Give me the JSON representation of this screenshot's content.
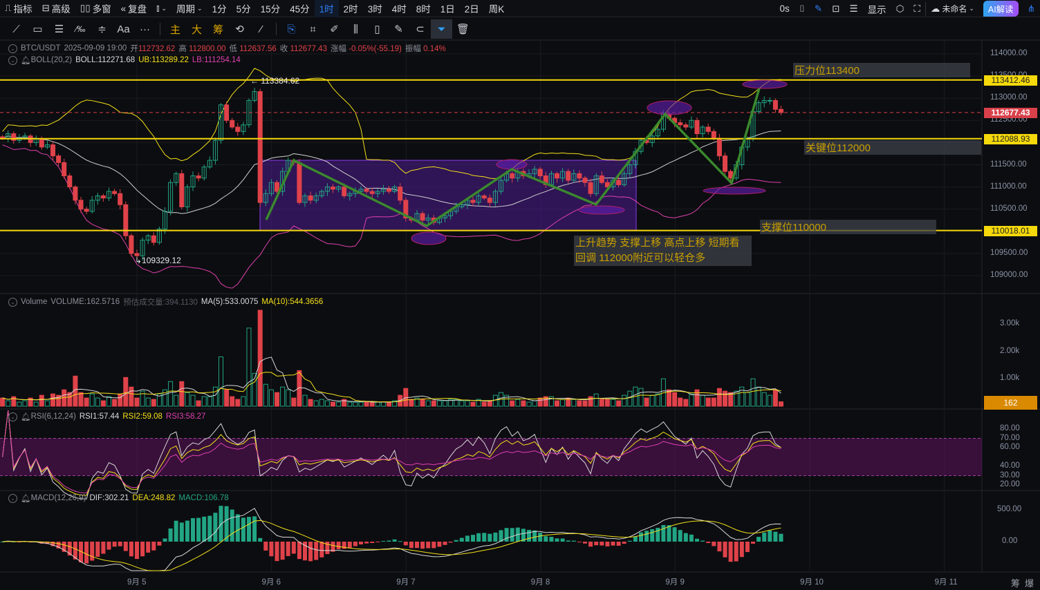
{
  "topbar": {
    "left": [
      {
        "label": "指标",
        "icon": "chart-icon"
      },
      {
        "label": "高级",
        "icon": "layout-icon"
      },
      {
        "label": "多窗",
        "icon": "grid-icon"
      },
      {
        "label": "复盘",
        "icon": "rewind-icon"
      }
    ],
    "chart_type_icon": "candlestick-icon",
    "period_label": "周期",
    "intervals": [
      "1分",
      "5分",
      "15分",
      "45分",
      "1时",
      "2时",
      "3时",
      "4时",
      "8时",
      "1日",
      "2日",
      "周K"
    ],
    "active_interval": "1时",
    "countdown": "0s",
    "display_label": "显示",
    "layout_name": "未命名",
    "ai_label": "AI解读"
  },
  "drawbar": {
    "text_tool": "Aa",
    "more": "···",
    "main": "主",
    "big": "大",
    "chips": "筹"
  },
  "ohlc": {
    "symbol": "BTC/USDT",
    "time": "2025-09-09 19:00",
    "open_label": "开",
    "open": "112732.62",
    "high_label": "高",
    "high": "112800.00",
    "low_label": "低",
    "low": "112637.56",
    "close_label": "收",
    "close": "112677.43",
    "change_label": "涨幅",
    "change": "-0.05%(-55.19)",
    "amp_label": "振幅",
    "amp": "0.14%"
  },
  "boll": {
    "name": "BOLL(20,2)",
    "mid": "BOLL:112271.68",
    "ub": "UB:113289.22",
    "lb": "LB:111254.14"
  },
  "volume": {
    "name": "Volume",
    "value": "VOLUME:162.5716",
    "est_label": "预估成交量",
    "est": ":394.1130",
    "ma5": "MA(5):533.0075",
    "ma10": "MA(10):544.3656"
  },
  "rsi": {
    "name": "RSI(6,12,24)",
    "rsi1": "RSI1:57.44",
    "rsi2": "RSI2:59.08",
    "rsi3": "RSI3:58.27"
  },
  "macd": {
    "name": "MACD(12,26,9)",
    "dif": "DIF:302.21",
    "dea": "DEA:248.82",
    "macd": "MACD:106.78"
  },
  "price_axis": [
    "114000.00",
    "113500.00",
    "113000.00",
    "112500.00",
    "112000.00",
    "111500.00",
    "111000.00",
    "110500.00",
    "110000.00",
    "109500.00",
    "109000.00"
  ],
  "price_tags": {
    "resistance": "113412.46",
    "current": "112677.43",
    "key": "112088.93",
    "support": "110018.01"
  },
  "volume_axis": [
    "3.00k",
    "2.00k",
    "1.00k"
  ],
  "volume_tag": "162",
  "rsi_axis": [
    "80.00",
    "70.00",
    "60.00",
    "40.00",
    "30.00",
    "20.00"
  ],
  "macd_axis": [
    "500.00",
    "0.00"
  ],
  "date_axis": [
    "9月 5",
    "9月 6",
    "9月 7",
    "9月 8",
    "9月 9",
    "9月 10",
    "9月 11"
  ],
  "bottom_right": [
    "筹",
    "爆"
  ],
  "annotations": {
    "resistance": "压力位113400",
    "key": "关键位112000",
    "support": "支撑位110000",
    "comment_line1": "上升趋势 支撑上移 高点上移 短期看",
    "comment_line2": "回调  112000附近可以轻仓多",
    "high_mark": "113384.62",
    "low_mark": "109329.12"
  },
  "colors": {
    "up": "#22a584",
    "down": "#e0424a",
    "boll_mid": "#d0d0d0",
    "boll_ub": "#f5e11a",
    "boll_lb": "#e040b0",
    "level": "#f5d90a",
    "accent": "#2f7ef5"
  },
  "chart_data": {
    "type": "candlestick",
    "interval": "1h",
    "start": "2025-09-04 00:00",
    "closes": [
      112100,
      112200,
      112050,
      112100,
      112150,
      112000,
      112080,
      111900,
      111950,
      111700,
      111550,
      111250,
      111000,
      110700,
      110500,
      110450,
      110700,
      110800,
      110750,
      110900,
      110850,
      110600,
      109900,
      109500,
      109450,
      109800,
      109900,
      109750,
      110050,
      110450,
      111100,
      111300,
      110550,
      111000,
      111250,
      111200,
      111450,
      111600,
      112050,
      112850,
      112500,
      112350,
      112250,
      112400,
      112950,
      113150,
      110650,
      110850,
      111100,
      110900,
      111350,
      111600,
      111550,
      110650,
      110800,
      110700,
      110800,
      110900,
      111000,
      110950,
      111000,
      110800,
      110850,
      110900,
      110950,
      110900,
      110850,
      110900,
      110950,
      110900,
      111000,
      110700,
      110300,
      110250,
      110400,
      110250,
      110300,
      110200,
      110300,
      110350,
      110450,
      110550,
      110600,
      110700,
      110650,
      110800,
      110750,
      110650,
      110900,
      111150,
      111300,
      111200,
      111350,
      111250,
      111300,
      111400,
      111250,
      111050,
      111300,
      111200,
      111350,
      111150,
      111300,
      111200,
      111100,
      110850,
      111250,
      111100,
      111000,
      111150,
      111050,
      111300,
      111500,
      111800,
      112050,
      112000,
      112150,
      112300,
      112650,
      112550,
      112450,
      112400,
      112350,
      112500,
      112200,
      112350,
      112250,
      112100,
      111700,
      111350,
      111200,
      111500,
      111900,
      112100,
      112700,
      112900,
      112950,
      112950,
      112750,
      112677
    ],
    "volumes": [
      300,
      200,
      350,
      150,
      200,
      300,
      150,
      400,
      200,
      450,
      400,
      600,
      500,
      1100,
      500,
      300,
      450,
      300,
      200,
      350,
      250,
      450,
      1050,
      700,
      300,
      550,
      300,
      250,
      450,
      600,
      900,
      400,
      900,
      500,
      400,
      200,
      350,
      350,
      700,
      1800,
      600,
      350,
      250,
      350,
      2850,
      1200,
      3500,
      800,
      600,
      500,
      700,
      600,
      300,
      1300,
      400,
      250,
      200,
      250,
      200,
      150,
      150,
      250,
      150,
      150,
      150,
      150,
      150,
      150,
      150,
      150,
      200,
      400,
      650,
      250,
      300,
      250,
      200,
      200,
      200,
      200,
      250,
      250,
      200,
      200,
      150,
      250,
      150,
      200,
      400,
      500,
      400,
      200,
      250,
      200,
      150,
      200,
      300,
      350,
      350,
      200,
      250,
      300,
      250,
      200,
      200,
      350,
      450,
      250,
      250,
      250,
      200,
      400,
      550,
      700,
      650,
      300,
      400,
      450,
      1000,
      600,
      500,
      300,
      250,
      450,
      600,
      400,
      300,
      300,
      650,
      550,
      500,
      550,
      700,
      500,
      1000,
      700,
      500,
      400,
      600,
      162
    ],
    "price_range": [
      108700,
      114300
    ],
    "levels": [
      113412.46,
      112088.93,
      110018.01
    ],
    "current_price": 112677.43
  }
}
